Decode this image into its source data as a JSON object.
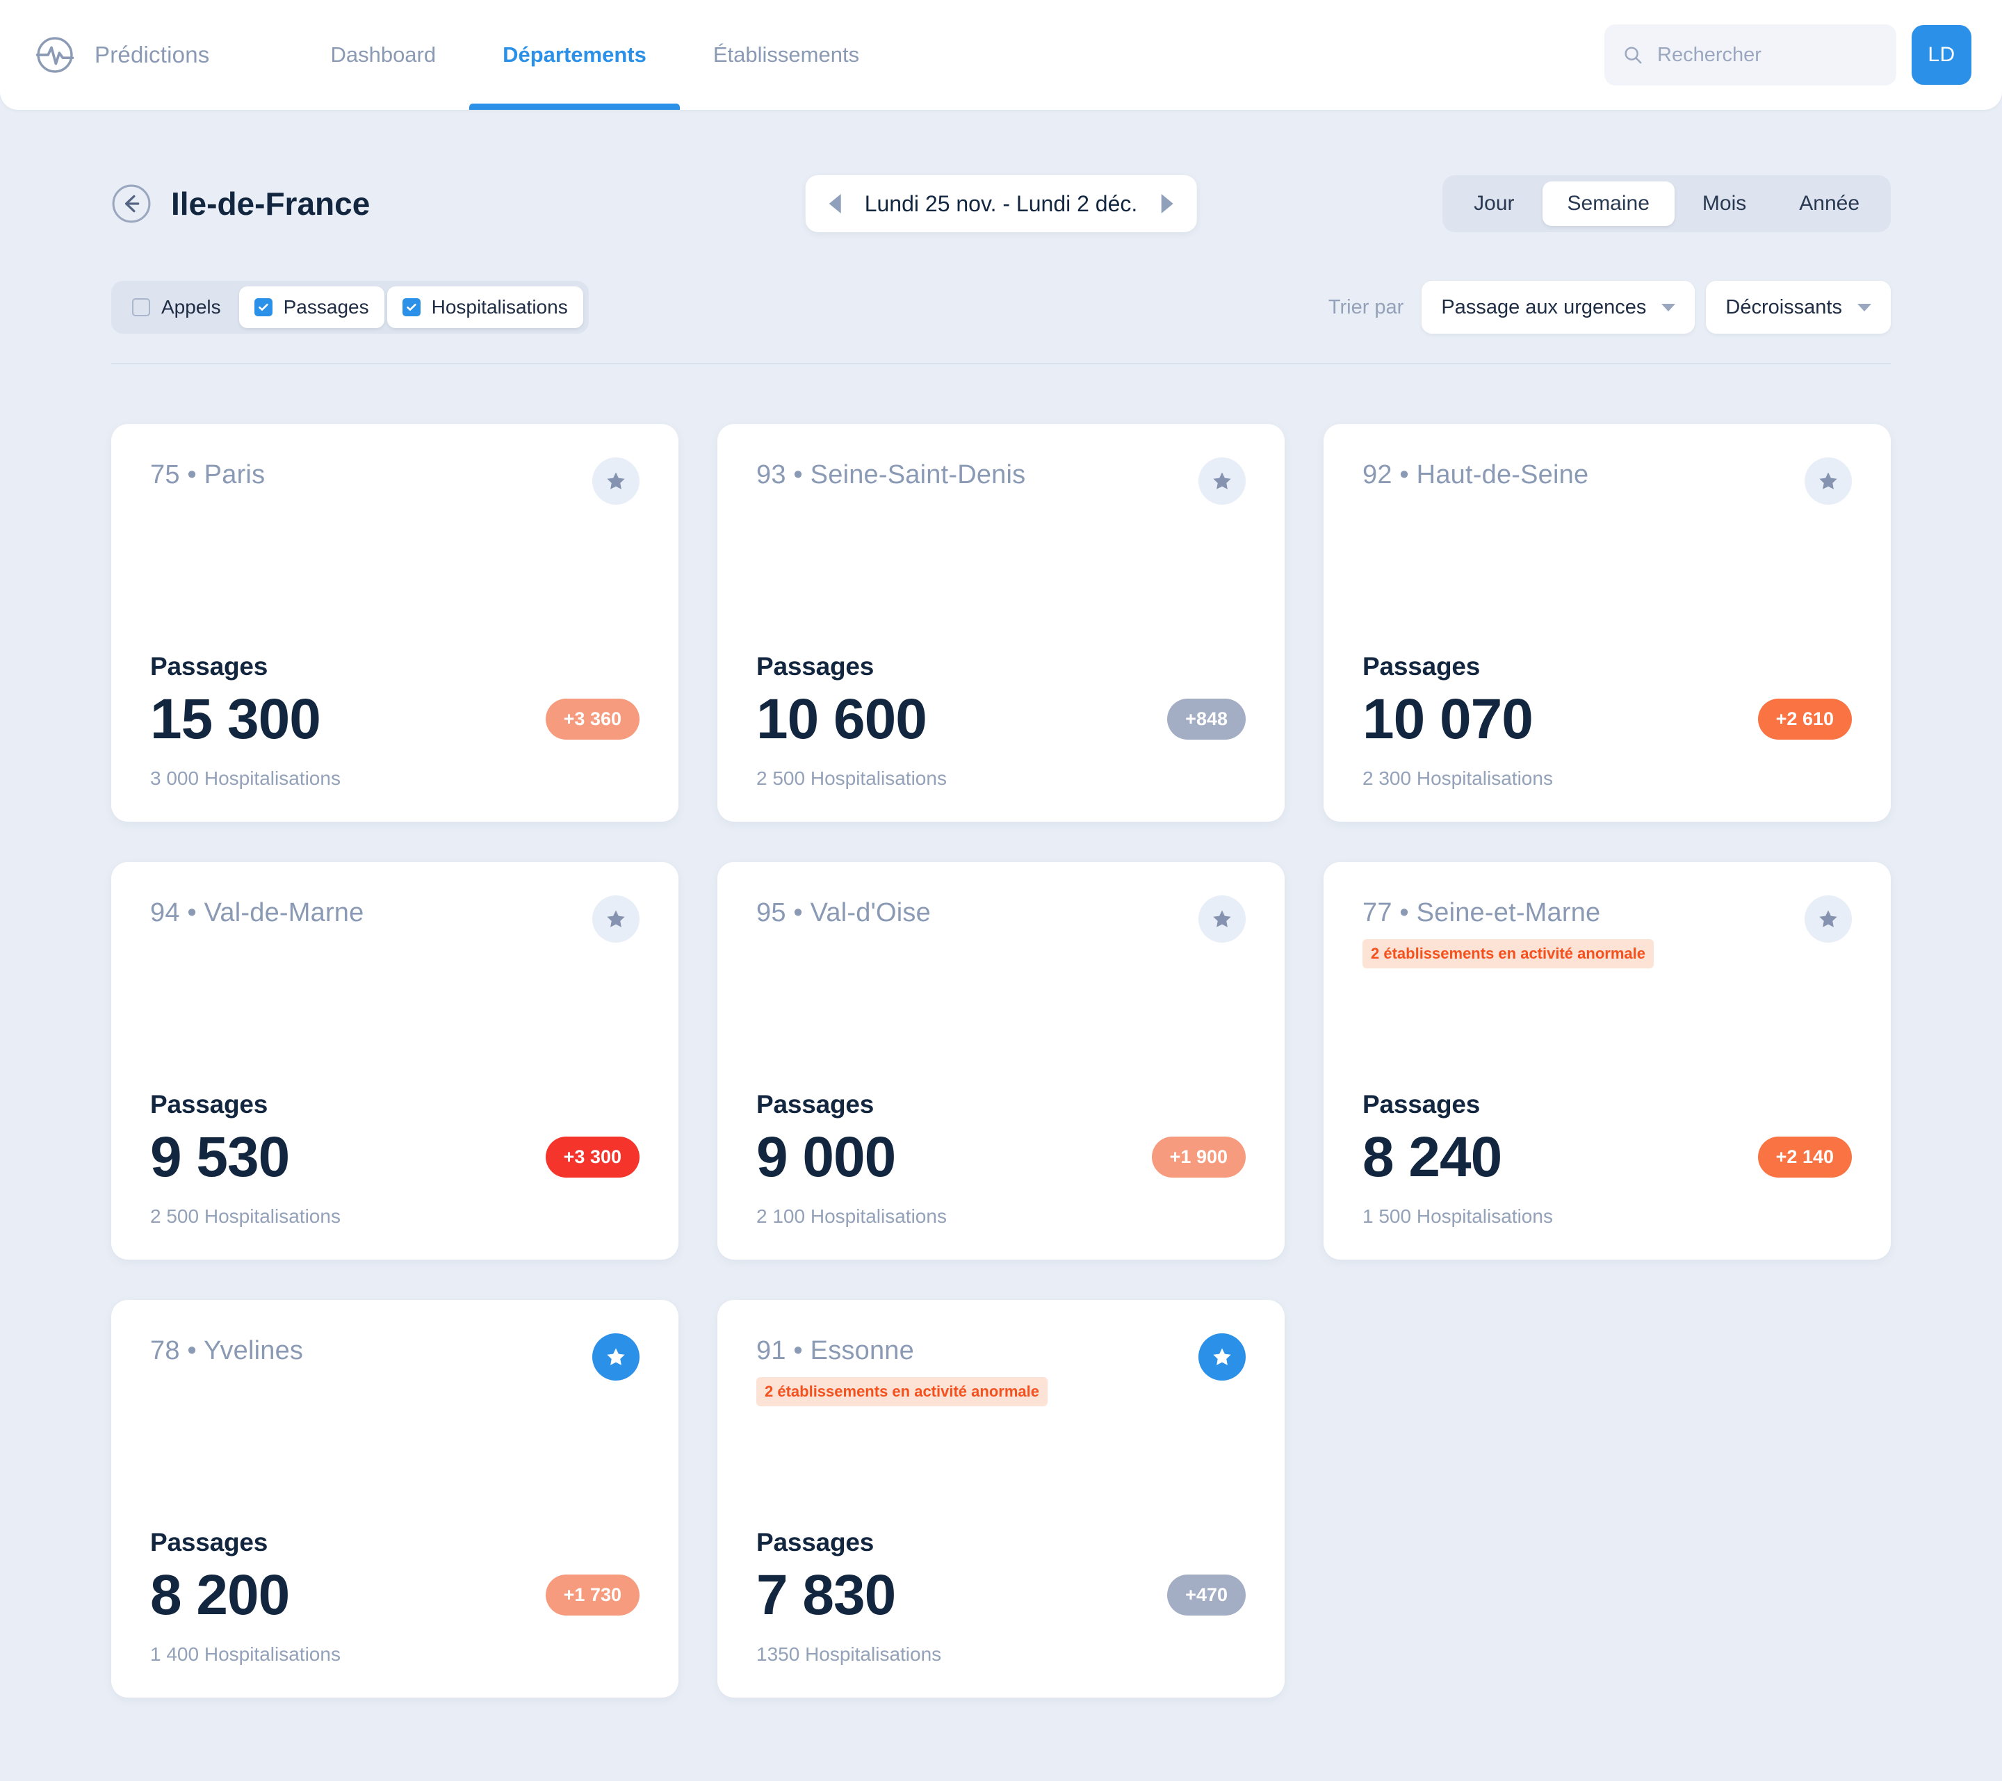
{
  "brand": {
    "name": "Prédictions",
    "logo_icon": "pulse-circle-icon"
  },
  "nav": {
    "items": [
      {
        "label": "Dashboard",
        "active": false
      },
      {
        "label": "Départements",
        "active": true
      },
      {
        "label": "Établissements",
        "active": false
      }
    ]
  },
  "search": {
    "placeholder": "Rechercher",
    "value": "",
    "icon": "search-icon"
  },
  "user": {
    "initials": "LD"
  },
  "header": {
    "back_icon": "arrow-left-circle-icon",
    "title": "Ile-de-France",
    "date_range": "Lundi 25 nov.  -  Lundi 2 déc.",
    "prev_icon": "triangle-left-icon",
    "next_icon": "triangle-right-icon"
  },
  "granularity": {
    "options": [
      {
        "label": "Jour",
        "active": false
      },
      {
        "label": "Semaine",
        "active": true
      },
      {
        "label": "Mois",
        "active": false
      },
      {
        "label": "Année",
        "active": false
      }
    ]
  },
  "filters": {
    "chips": [
      {
        "label": "Appels",
        "checked": false
      },
      {
        "label": "Passages",
        "checked": true
      },
      {
        "label": "Hospitalisations",
        "checked": true
      }
    ]
  },
  "sort": {
    "label": "Trier par",
    "field": "Passage aux urgences",
    "direction": "Décroissants",
    "caret_icon": "chevron-down-icon"
  },
  "colors": {
    "accent": "#2b90e8",
    "page_bg": "#e9eef6",
    "text_dark": "#12263f",
    "text_muted": "#8b9ab4",
    "delta_red": "#f5352c",
    "delta_orange": "#f97murky",
    "delta_orange_strong": "#fa7343",
    "delta_salmon": "#f79b7e",
    "delta_grey": "#a3aec4",
    "alert_bg": "#fde3d6",
    "alert_text": "#f4511e"
  },
  "cards": [
    {
      "code": "75",
      "name": "Paris",
      "title": "75 • Paris",
      "favorite": false,
      "alert": null,
      "metric_label": "Passages",
      "metric_value": "15 300",
      "delta": "+3 360",
      "delta_color": "#f79b7e",
      "sub_metric": "3 000 Hospitalisations"
    },
    {
      "code": "93",
      "name": "Seine-Saint-Denis",
      "title": "93 • Seine-Saint-Denis",
      "favorite": false,
      "alert": null,
      "metric_label": "Passages",
      "metric_value": "10 600",
      "delta": "+848",
      "delta_color": "#a3aec4",
      "sub_metric": "2 500 Hospitalisations"
    },
    {
      "code": "92",
      "name": "Haut-de-Seine",
      "title": "92 • Haut-de-Seine",
      "favorite": false,
      "alert": null,
      "metric_label": "Passages",
      "metric_value": "10 070",
      "delta": "+2 610",
      "delta_color": "#fa7343",
      "sub_metric": "2 300 Hospitalisations"
    },
    {
      "code": "94",
      "name": "Val-de-Marne",
      "title": "94 • Val-de-Marne",
      "favorite": false,
      "alert": null,
      "metric_label": "Passages",
      "metric_value": "9 530",
      "delta": "+3 300",
      "delta_color": "#f5352c",
      "sub_metric": "2 500 Hospitalisations"
    },
    {
      "code": "95",
      "name": "Val-d'Oise",
      "title": "95 • Val-d'Oise",
      "favorite": false,
      "alert": null,
      "metric_label": "Passages",
      "metric_value": "9 000",
      "delta": "+1 900",
      "delta_color": "#f79b7e",
      "sub_metric": "2 100 Hospitalisations"
    },
    {
      "code": "77",
      "name": "Seine-et-Marne",
      "title": "77 • Seine-et-Marne",
      "favorite": false,
      "alert": "2 établissements en activité anormale",
      "metric_label": "Passages",
      "metric_value": "8 240",
      "delta": "+2 140",
      "delta_color": "#fa7343",
      "sub_metric": "1 500 Hospitalisations"
    },
    {
      "code": "78",
      "name": "Yvelines",
      "title": "78 • Yvelines",
      "favorite": true,
      "alert": null,
      "metric_label": "Passages",
      "metric_value": "8 200",
      "delta": "+1 730",
      "delta_color": "#f79b7e",
      "sub_metric": "1 400 Hospitalisations"
    },
    {
      "code": "91",
      "name": "Essonne",
      "title": "91 • Essonne",
      "favorite": true,
      "alert": "2 établissements en activité anormale",
      "metric_label": "Passages",
      "metric_value": "7 830",
      "delta": "+470",
      "delta_color": "#a3aec4",
      "sub_metric": "1350 Hospitalisations"
    }
  ]
}
